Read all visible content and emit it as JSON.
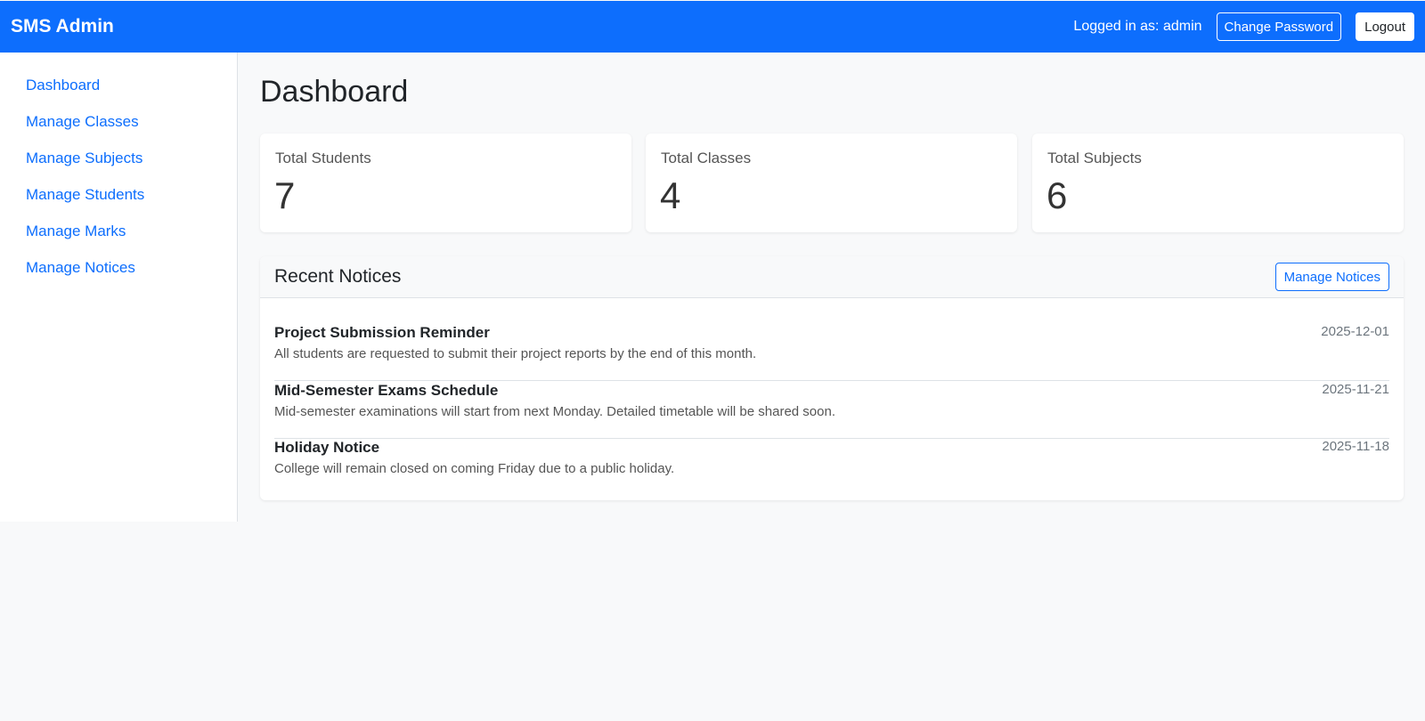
{
  "navbar": {
    "brand": "SMS Admin",
    "user_text": "Logged in as: admin",
    "change_password_label": "Change Password",
    "logout_label": "Logout",
    "bg_color": "#0d6efd"
  },
  "sidebar": {
    "items": [
      {
        "label": "Dashboard"
      },
      {
        "label": "Manage Classes"
      },
      {
        "label": "Manage Subjects"
      },
      {
        "label": "Manage Students"
      },
      {
        "label": "Manage Marks"
      },
      {
        "label": "Manage Notices"
      }
    ]
  },
  "main": {
    "title": "Dashboard",
    "stats": [
      {
        "label": "Total Students",
        "value": "7"
      },
      {
        "label": "Total Classes",
        "value": "4"
      },
      {
        "label": "Total Subjects",
        "value": "6"
      }
    ],
    "notices": {
      "title": "Recent Notices",
      "manage_label": "Manage Notices",
      "items": [
        {
          "title": "Project Submission Reminder",
          "body": "All students are requested to submit their project reports by the end of this month.",
          "date": "2025-12-01"
        },
        {
          "title": "Mid-Semester Exams Schedule",
          "body": "Mid-semester examinations will start from next Monday. Detailed timetable will be shared soon.",
          "date": "2025-11-21"
        },
        {
          "title": "Holiday Notice",
          "body": "College will remain closed on coming Friday due to a public holiday.",
          "date": "2025-11-18"
        }
      ]
    }
  }
}
